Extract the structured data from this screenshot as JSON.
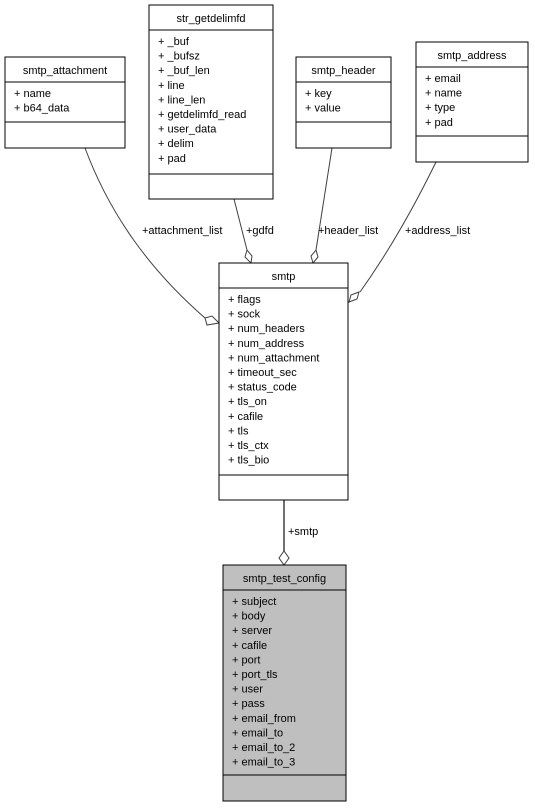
{
  "classes": {
    "str_getdelimfd": {
      "name": "str_getdelimfd",
      "attrs": [
        "+ _buf",
        "+ _bufsz",
        "+ _buf_len",
        "+ line",
        "+ line_len",
        "+ getdelimfd_read",
        "+ user_data",
        "+ delim",
        "+ pad"
      ]
    },
    "smtp_attachment": {
      "name": "smtp_attachment",
      "attrs": [
        "+ name",
        "+ b64_data"
      ]
    },
    "smtp_header": {
      "name": "smtp_header",
      "attrs": [
        "+ key",
        "+ value"
      ]
    },
    "smtp_address": {
      "name": "smtp_address",
      "attrs": [
        "+ email",
        "+ name",
        "+ type",
        "+ pad"
      ]
    },
    "smtp": {
      "name": "smtp",
      "attrs": [
        "+ flags",
        "+ sock",
        "+ num_headers",
        "+ num_address",
        "+ num_attachment",
        "+ timeout_sec",
        "+ status_code",
        "+ tls_on",
        "+ cafile",
        "+ tls",
        "+ tls_ctx",
        "+ tls_bio"
      ]
    },
    "smtp_test_config": {
      "name": "smtp_test_config",
      "highlight_color": "#bfbfbf",
      "attrs": [
        "+ subject",
        "+ body",
        "+ server",
        "+ cafile",
        "+ port",
        "+ port_tls",
        "+ user",
        "+ pass",
        "+ email_from",
        "+ email_to",
        "+ email_to_2",
        "+ email_to_3"
      ]
    }
  },
  "edges": {
    "attachment_list": "+attachment_list",
    "gdfd": "+gdfd",
    "header_list": "+header_list",
    "address_list": "+address_list",
    "smtp": "+smtp"
  }
}
